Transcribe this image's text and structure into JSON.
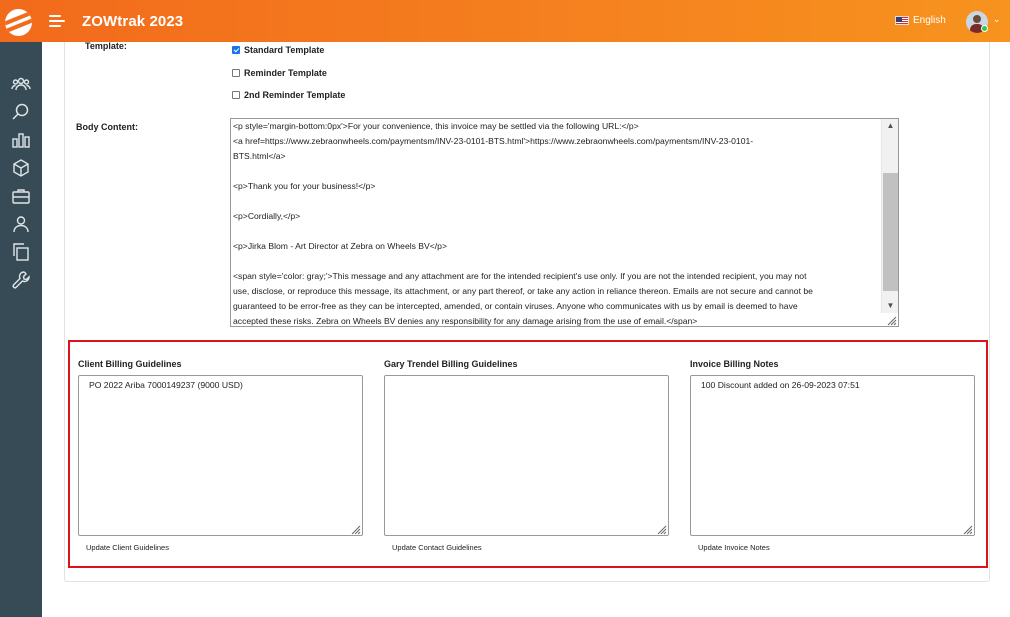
{
  "header": {
    "app_title": "ZOWtrak 2023",
    "language": "English",
    "accent_color": "#f5821f"
  },
  "sidebar": {
    "items": [
      {
        "icon": "team-icon"
      },
      {
        "icon": "search-icon"
      },
      {
        "icon": "bar-chart-icon"
      },
      {
        "icon": "box-icon"
      },
      {
        "icon": "briefcase-icon"
      },
      {
        "icon": "user-icon"
      },
      {
        "icon": "copy-icon"
      },
      {
        "icon": "wrench-icon"
      }
    ]
  },
  "form": {
    "template_label": "Template:",
    "templates": [
      {
        "label": "Standard Template",
        "checked": true
      },
      {
        "label": "Reminder Template",
        "checked": false
      },
      {
        "label": "2nd Reminder Template",
        "checked": false
      }
    ],
    "body_label": "Body Content:",
    "body_content": "<p style='margin-bottom:0px'>For your convenience, this invoice may be settled via the following URL:</p>\n<a href=https://www.zebraonwheels.com/paymentsm/INV-23-0101-BTS.html'>https://www.zebraonwheels.com/paymentsm/INV-23-0101-\nBTS.html</a>\n\n<p>Thank you for your business!</p>\n\n<p>Cordially,</p>\n\n<p>Jirka Blom - Art Director at Zebra on Wheels BV</p>\n\n<span style='color: gray;'>This message and any attachment are for the intended recipient's use only. If you are not the intended recipient, you may not\nuse, disclose, or reproduce this message, its attachment, or any part thereof, or take any action in reliance thereon. Emails are not secure and cannot be\nguaranteed to be error-free as they can be intercepted, amended, or contain viruses. Anyone who communicates with us by email is deemed to have\naccepted these risks. Zebra on Wheels BV denies any responsibility for any damage arising from the use of email.</span>"
  },
  "guidelines": {
    "client": {
      "title": "Client Billing Guidelines",
      "text": "PO 2022 Ariba 7000149237 (9000 USD)",
      "link": "Update Client Guidelines"
    },
    "contact": {
      "title": "Gary Trendel Billing Guidelines",
      "text": "",
      "link": "Update Contact Guidelines"
    },
    "invoice": {
      "title": "Invoice Billing Notes",
      "text": "100 Discount added on 26-09-2023 07:51",
      "link": "Update Invoice Notes"
    }
  },
  "colors": {
    "sidebar_bg": "#364b55",
    "highlight_border": "#d9151b"
  }
}
